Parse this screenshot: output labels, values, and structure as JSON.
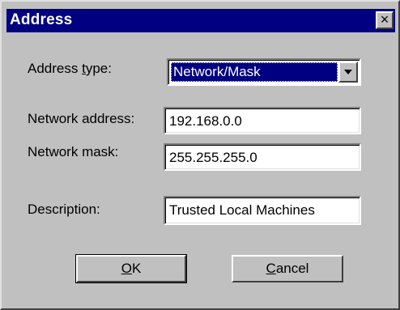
{
  "dialog": {
    "title": "Address",
    "close_glyph": "×",
    "close_icon": "close-icon"
  },
  "form": {
    "address_type": {
      "label_prefix": "Address ",
      "label_mnemonic": "t",
      "label_suffix": "ype:",
      "value": "Network/Mask",
      "arrow_icon": "chevron-down-icon"
    },
    "network_address": {
      "label": "Network address:",
      "value": "192.168.0.0"
    },
    "network_mask": {
      "label": "Network mask:",
      "value": "255.255.255.0"
    },
    "description": {
      "label": "Description:",
      "value": "Trusted Local Machines"
    }
  },
  "buttons": {
    "ok": {
      "mnemonic": "O",
      "rest": "K"
    },
    "cancel": {
      "mnemonic": "C",
      "rest": "ancel"
    }
  },
  "colors": {
    "titlebar": "#000080",
    "face": "#c0c0c0",
    "selection": "#000080"
  }
}
